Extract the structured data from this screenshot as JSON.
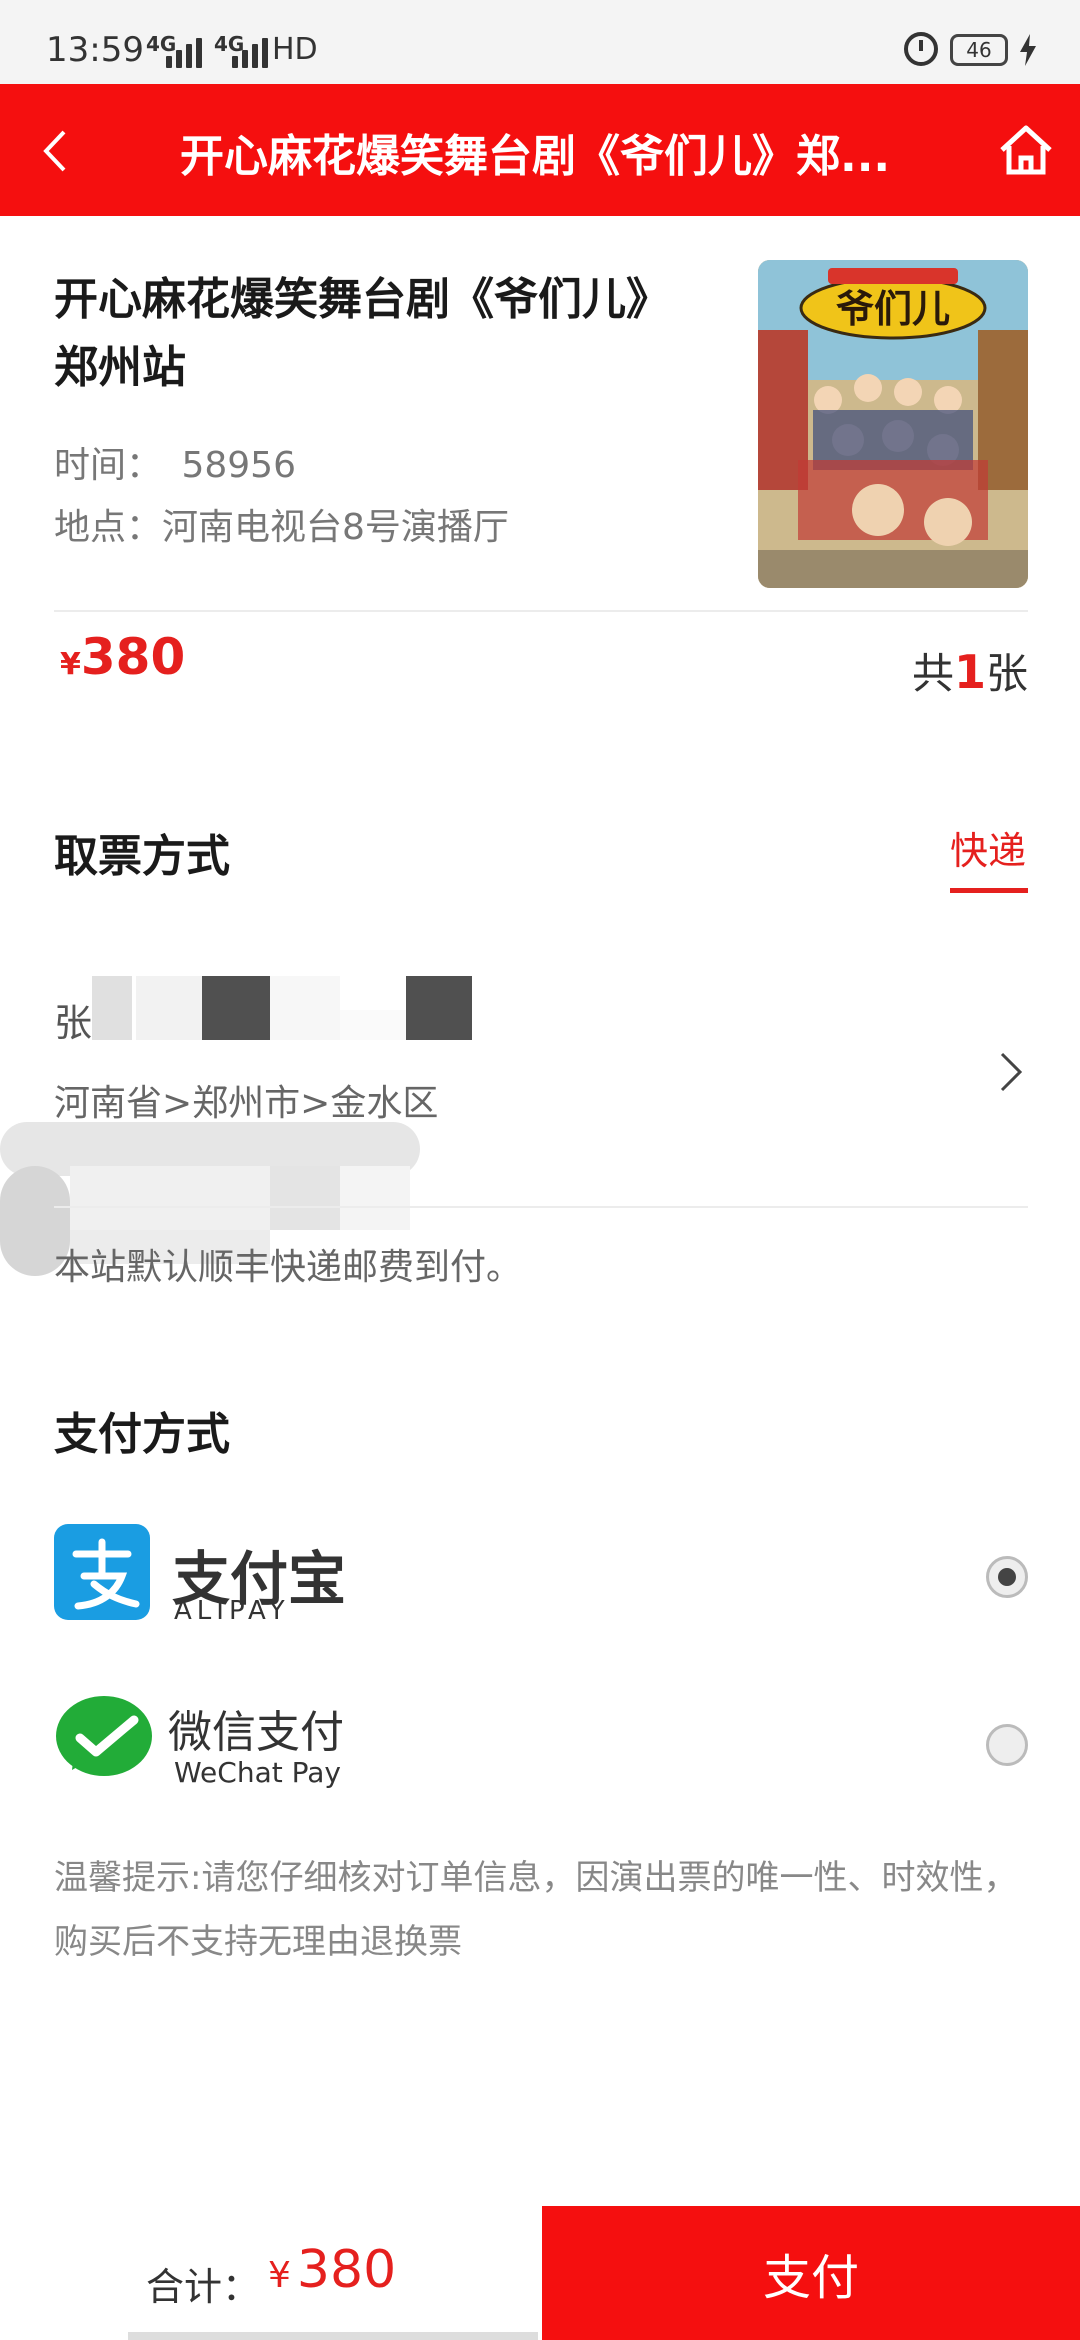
{
  "status_bar": {
    "time": "13:59",
    "network": "HD",
    "battery": "46",
    "icons": [
      "signal-4g-icon",
      "signal-4g-icon",
      "alarm-icon",
      "battery-icon",
      "charging-icon"
    ]
  },
  "header": {
    "title": "开心麻花爆笑舞台剧《爷们儿》郑...",
    "back_icon": "chevron-left-icon",
    "home_icon": "home-icon",
    "color": "#f50f0f"
  },
  "event": {
    "title_line1": "开心麻花爆笑舞台剧《爷们儿》",
    "title_line2": "郑州站",
    "time_label": "时间：",
    "time_value": "58956",
    "venue_label": "地点：",
    "venue_value": "河南电视台8号演播厅",
    "poster_alt": "爷们儿",
    "price_symbol": "¥",
    "price": "380",
    "qty_prefix": "共",
    "qty": "1",
    "qty_suffix": "张"
  },
  "pickup": {
    "section_title": "取票方式",
    "method": "快递",
    "name_partial": "张",
    "region": "河南省>郑州市>金水区",
    "note": "本站默认顺丰快递邮费到付。"
  },
  "payment": {
    "section_title": "支付方式",
    "options": [
      {
        "name": "支付宝",
        "sub": "ALIPAY",
        "icon": "alipay-icon",
        "selected": true
      },
      {
        "name": "微信支付",
        "sub": "WeChat Pay",
        "icon": "wechat-pay-icon",
        "selected": false
      }
    ]
  },
  "tip": "温馨提示:请您仔细核对订单信息，因演出票的唯一性、时效性，购买后不支持无理由退换票",
  "footer": {
    "total_label": "合计：",
    "total_symbol": "¥",
    "total_value": "380",
    "pay_button": "支付"
  },
  "colors": {
    "accent": "#f50f0f",
    "price": "#e5201e",
    "alipay": "#1a9de2",
    "wechat": "#22ac38"
  }
}
